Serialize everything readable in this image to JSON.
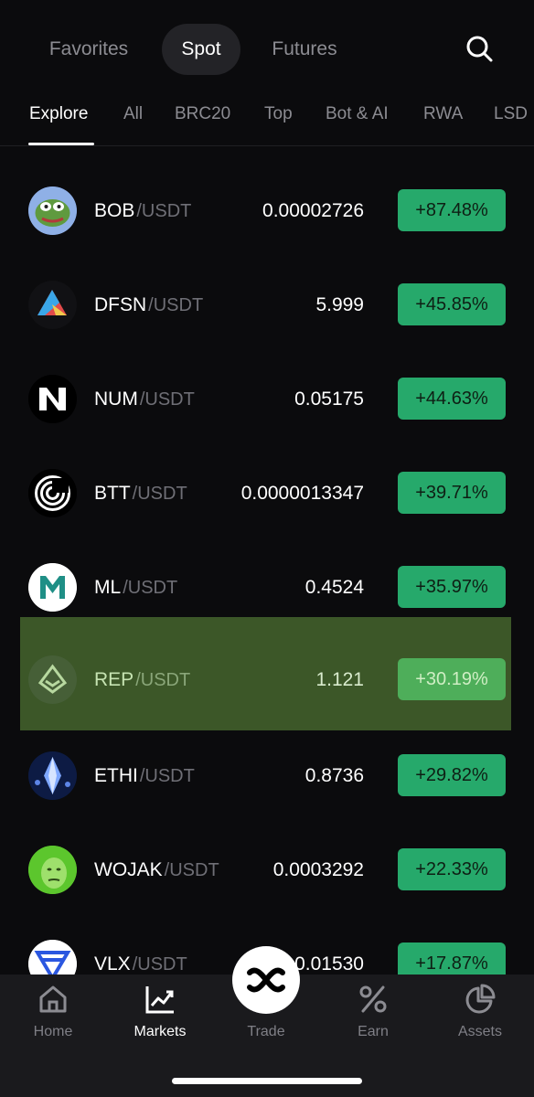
{
  "mode_tabs": [
    {
      "label": "Favorites"
    },
    {
      "label": "Spot"
    },
    {
      "label": "Futures"
    }
  ],
  "search": {
    "icon": "search-icon"
  },
  "category_tabs": [
    {
      "label": "Explore"
    },
    {
      "label": "All"
    },
    {
      "label": "BRC20"
    },
    {
      "label": "Top"
    },
    {
      "label": "Bot & AI"
    },
    {
      "label": "RWA"
    },
    {
      "label": "LSD"
    }
  ],
  "markets": [
    {
      "base": "BOB",
      "quote": "/USDT",
      "price": "0.00002726",
      "change": "+87.48%",
      "icon": "bob-coin-icon"
    },
    {
      "base": "DFSN",
      "quote": "/USDT",
      "price": "5.999",
      "change": "+45.85%",
      "icon": "dfsn-coin-icon"
    },
    {
      "base": "NUM",
      "quote": "/USDT",
      "price": "0.05175",
      "change": "+44.63%",
      "icon": "num-coin-icon"
    },
    {
      "base": "BTT",
      "quote": "/USDT",
      "price": "0.0000013347",
      "change": "+39.71%",
      "icon": "btt-coin-icon"
    },
    {
      "base": "ML",
      "quote": "/USDT",
      "price": "0.4524",
      "change": "+35.97%",
      "icon": "ml-coin-icon"
    },
    {
      "base": "REP",
      "quote": "/USDT",
      "price": "1.121",
      "change": "+30.19%",
      "icon": "rep-coin-icon"
    },
    {
      "base": "ETHI",
      "quote": "/USDT",
      "price": "0.8736",
      "change": "+29.82%",
      "icon": "ethi-coin-icon"
    },
    {
      "base": "WOJAK",
      "quote": "/USDT",
      "price": "0.0003292",
      "change": "+22.33%",
      "icon": "wojak-coin-icon"
    },
    {
      "base": "VLX",
      "quote": "/USDT",
      "price": "0.01530",
      "change": "+17.87%",
      "icon": "vlx-coin-icon"
    }
  ],
  "bottom_nav": {
    "home": "Home",
    "markets": "Markets",
    "trade": "Trade",
    "earn": "Earn",
    "assets": "Assets"
  },
  "colors": {
    "background": "#0b0b0d",
    "positive_badge": "#26a96b",
    "highlight_row": "#3c5728"
  }
}
